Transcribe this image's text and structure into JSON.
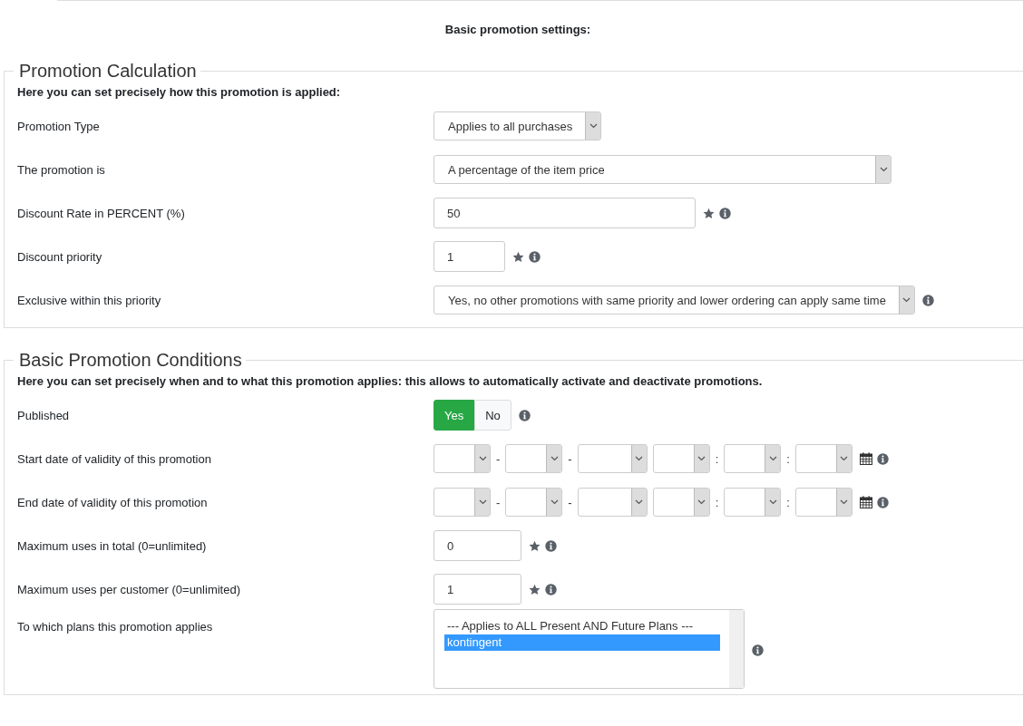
{
  "heading": "Basic promotion settings:",
  "sections": [
    {
      "title": "Promotion Calculation",
      "intro": "Here you can set precisely how this promotion is applied:",
      "rows": [
        {
          "kind": "select",
          "label": "Promotion Type",
          "value": "Applies to all purchases",
          "required": false,
          "help": false
        },
        {
          "kind": "select",
          "label": "The promotion is",
          "value": "A percentage of the item price",
          "required": false,
          "help": false
        },
        {
          "kind": "input",
          "label": "Discount Rate in PERCENT (%)",
          "value": "50",
          "required": true,
          "help": true
        },
        {
          "kind": "input",
          "label": "Discount priority",
          "value": "1",
          "required": true,
          "help": true
        },
        {
          "kind": "select",
          "label": "Exclusive within this priority",
          "value": "Yes, no other promotions with same priority and lower ordering can apply same time",
          "required": false,
          "help": true
        }
      ]
    },
    {
      "title": "Basic Promotion Conditions",
      "intro": "Here you can set precisely when and to what this promotion applies: this allows to automatically activate and deactivate promotions.",
      "rows": [
        {
          "kind": "toggle",
          "label": "Published",
          "options": [
            {
              "label": "Yes",
              "selected": true
            },
            {
              "label": "No",
              "selected": false
            }
          ],
          "required": false,
          "help": true
        },
        {
          "kind": "datetime",
          "label": "Start date of validity of this promotion",
          "parts": [
            {
              "kind": "select"
            },
            {
              "kind": "sep",
              "text": "-"
            },
            {
              "kind": "select"
            },
            {
              "kind": "sep",
              "text": "-"
            },
            {
              "kind": "select"
            },
            {
              "kind": "select"
            },
            {
              "kind": "sep",
              "text": ":"
            },
            {
              "kind": "select"
            },
            {
              "kind": "sep",
              "text": ":"
            },
            {
              "kind": "select"
            }
          ],
          "required": false,
          "help": true
        },
        {
          "kind": "datetime",
          "label": "End date of validity of this promotion",
          "parts": [
            {
              "kind": "select"
            },
            {
              "kind": "sep",
              "text": "-"
            },
            {
              "kind": "select"
            },
            {
              "kind": "sep",
              "text": "-"
            },
            {
              "kind": "select"
            },
            {
              "kind": "select"
            },
            {
              "kind": "sep",
              "text": ":"
            },
            {
              "kind": "select"
            },
            {
              "kind": "sep",
              "text": ":"
            },
            {
              "kind": "select"
            }
          ],
          "required": false,
          "help": true
        },
        {
          "kind": "input",
          "label": "Maximum uses in total (0=unlimited)",
          "value": "0",
          "required": true,
          "help": true
        },
        {
          "kind": "input",
          "label": "Maximum uses per customer (0=unlimited)",
          "value": "1",
          "required": true,
          "help": true
        },
        {
          "kind": "listbox",
          "label": "To which plans this promotion applies",
          "options": [
            {
              "label": "--- Applies to ALL Present AND Future Plans ---",
              "selected": false
            },
            {
              "label": "kontingent",
              "selected": true
            }
          ],
          "required": false,
          "help": true
        }
      ]
    }
  ]
}
